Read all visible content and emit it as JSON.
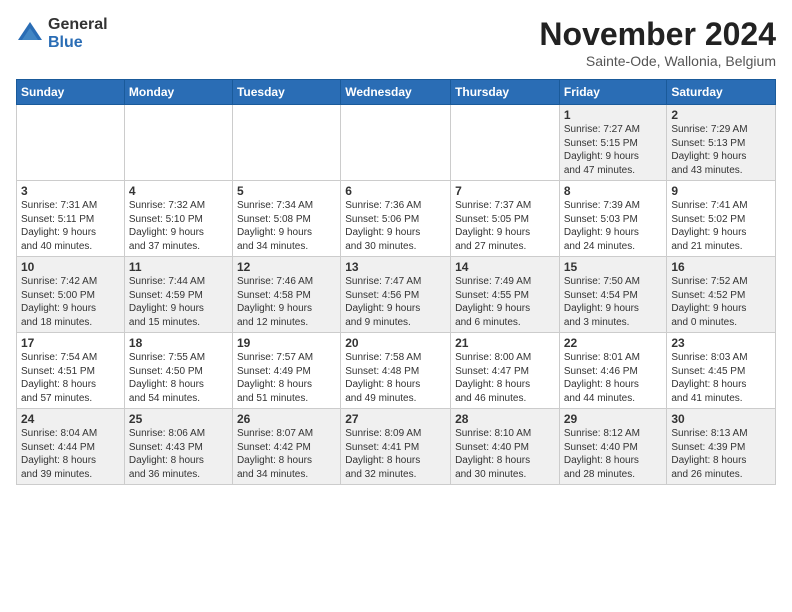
{
  "logo": {
    "general": "General",
    "blue": "Blue"
  },
  "header": {
    "month": "November 2024",
    "location": "Sainte-Ode, Wallonia, Belgium"
  },
  "weekdays": [
    "Sunday",
    "Monday",
    "Tuesday",
    "Wednesday",
    "Thursday",
    "Friday",
    "Saturday"
  ],
  "weeks": [
    [
      {
        "day": "",
        "info": ""
      },
      {
        "day": "",
        "info": ""
      },
      {
        "day": "",
        "info": ""
      },
      {
        "day": "",
        "info": ""
      },
      {
        "day": "",
        "info": ""
      },
      {
        "day": "1",
        "info": "Sunrise: 7:27 AM\nSunset: 5:15 PM\nDaylight: 9 hours\nand 47 minutes."
      },
      {
        "day": "2",
        "info": "Sunrise: 7:29 AM\nSunset: 5:13 PM\nDaylight: 9 hours\nand 43 minutes."
      }
    ],
    [
      {
        "day": "3",
        "info": "Sunrise: 7:31 AM\nSunset: 5:11 PM\nDaylight: 9 hours\nand 40 minutes."
      },
      {
        "day": "4",
        "info": "Sunrise: 7:32 AM\nSunset: 5:10 PM\nDaylight: 9 hours\nand 37 minutes."
      },
      {
        "day": "5",
        "info": "Sunrise: 7:34 AM\nSunset: 5:08 PM\nDaylight: 9 hours\nand 34 minutes."
      },
      {
        "day": "6",
        "info": "Sunrise: 7:36 AM\nSunset: 5:06 PM\nDaylight: 9 hours\nand 30 minutes."
      },
      {
        "day": "7",
        "info": "Sunrise: 7:37 AM\nSunset: 5:05 PM\nDaylight: 9 hours\nand 27 minutes."
      },
      {
        "day": "8",
        "info": "Sunrise: 7:39 AM\nSunset: 5:03 PM\nDaylight: 9 hours\nand 24 minutes."
      },
      {
        "day": "9",
        "info": "Sunrise: 7:41 AM\nSunset: 5:02 PM\nDaylight: 9 hours\nand 21 minutes."
      }
    ],
    [
      {
        "day": "10",
        "info": "Sunrise: 7:42 AM\nSunset: 5:00 PM\nDaylight: 9 hours\nand 18 minutes."
      },
      {
        "day": "11",
        "info": "Sunrise: 7:44 AM\nSunset: 4:59 PM\nDaylight: 9 hours\nand 15 minutes."
      },
      {
        "day": "12",
        "info": "Sunrise: 7:46 AM\nSunset: 4:58 PM\nDaylight: 9 hours\nand 12 minutes."
      },
      {
        "day": "13",
        "info": "Sunrise: 7:47 AM\nSunset: 4:56 PM\nDaylight: 9 hours\nand 9 minutes."
      },
      {
        "day": "14",
        "info": "Sunrise: 7:49 AM\nSunset: 4:55 PM\nDaylight: 9 hours\nand 6 minutes."
      },
      {
        "day": "15",
        "info": "Sunrise: 7:50 AM\nSunset: 4:54 PM\nDaylight: 9 hours\nand 3 minutes."
      },
      {
        "day": "16",
        "info": "Sunrise: 7:52 AM\nSunset: 4:52 PM\nDaylight: 9 hours\nand 0 minutes."
      }
    ],
    [
      {
        "day": "17",
        "info": "Sunrise: 7:54 AM\nSunset: 4:51 PM\nDaylight: 8 hours\nand 57 minutes."
      },
      {
        "day": "18",
        "info": "Sunrise: 7:55 AM\nSunset: 4:50 PM\nDaylight: 8 hours\nand 54 minutes."
      },
      {
        "day": "19",
        "info": "Sunrise: 7:57 AM\nSunset: 4:49 PM\nDaylight: 8 hours\nand 51 minutes."
      },
      {
        "day": "20",
        "info": "Sunrise: 7:58 AM\nSunset: 4:48 PM\nDaylight: 8 hours\nand 49 minutes."
      },
      {
        "day": "21",
        "info": "Sunrise: 8:00 AM\nSunset: 4:47 PM\nDaylight: 8 hours\nand 46 minutes."
      },
      {
        "day": "22",
        "info": "Sunrise: 8:01 AM\nSunset: 4:46 PM\nDaylight: 8 hours\nand 44 minutes."
      },
      {
        "day": "23",
        "info": "Sunrise: 8:03 AM\nSunset: 4:45 PM\nDaylight: 8 hours\nand 41 minutes."
      }
    ],
    [
      {
        "day": "24",
        "info": "Sunrise: 8:04 AM\nSunset: 4:44 PM\nDaylight: 8 hours\nand 39 minutes."
      },
      {
        "day": "25",
        "info": "Sunrise: 8:06 AM\nSunset: 4:43 PM\nDaylight: 8 hours\nand 36 minutes."
      },
      {
        "day": "26",
        "info": "Sunrise: 8:07 AM\nSunset: 4:42 PM\nDaylight: 8 hours\nand 34 minutes."
      },
      {
        "day": "27",
        "info": "Sunrise: 8:09 AM\nSunset: 4:41 PM\nDaylight: 8 hours\nand 32 minutes."
      },
      {
        "day": "28",
        "info": "Sunrise: 8:10 AM\nSunset: 4:40 PM\nDaylight: 8 hours\nand 30 minutes."
      },
      {
        "day": "29",
        "info": "Sunrise: 8:12 AM\nSunset: 4:40 PM\nDaylight: 8 hours\nand 28 minutes."
      },
      {
        "day": "30",
        "info": "Sunrise: 8:13 AM\nSunset: 4:39 PM\nDaylight: 8 hours\nand 26 minutes."
      }
    ]
  ]
}
